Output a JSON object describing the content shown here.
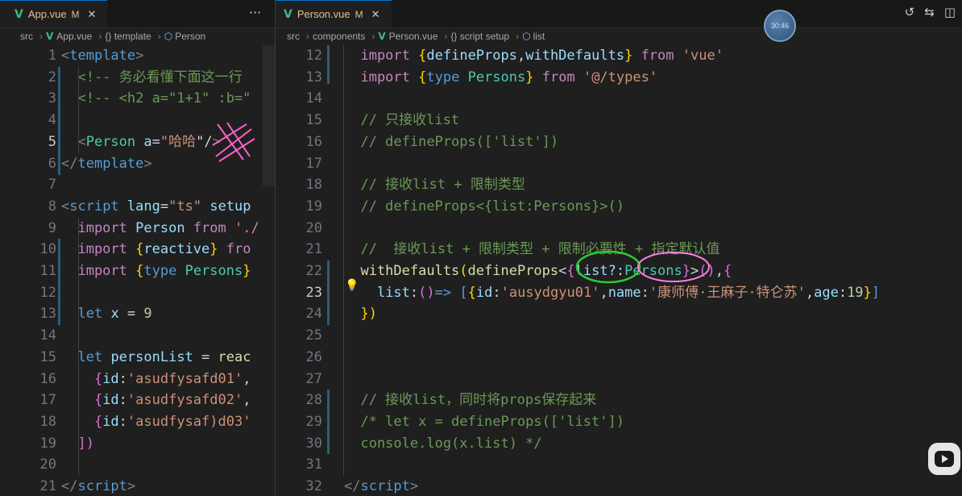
{
  "left_editor": {
    "tab": {
      "name": "App.vue",
      "modified": "M",
      "close": "✕"
    },
    "more": "···",
    "breadcrumb": [
      "src",
      "App.vue",
      "{} template",
      "Person"
    ],
    "lines": [
      {
        "n": "1",
        "t": [
          [
            "ang",
            "<"
          ],
          [
            "tag",
            "template"
          ],
          [
            "ang",
            ">"
          ]
        ]
      },
      {
        "n": "2",
        "t": [
          [
            "c",
            "  <!-- 务必看懂下面这一行"
          ]
        ]
      },
      {
        "n": "3",
        "t": [
          [
            "c",
            "  <!-- <h2 a=\"1+1\" :b=\""
          ]
        ]
      },
      {
        "n": "4",
        "t": []
      },
      {
        "n": "5",
        "t": [
          [
            "ang",
            "  <"
          ],
          [
            "t",
            "Person"
          ],
          [
            "w",
            " "
          ],
          [
            "v",
            "a"
          ],
          [
            "w",
            "="
          ],
          [
            "s",
            "\"哈哈"
          ],
          [
            "w",
            "\"/"
          ],
          [
            "ang",
            ">"
          ]
        ]
      },
      {
        "n": "6",
        "t": [
          [
            "ang",
            "</"
          ],
          [
            "tag",
            "template"
          ],
          [
            "ang",
            ">"
          ]
        ]
      },
      {
        "n": "7",
        "t": []
      },
      {
        "n": "8",
        "t": [
          [
            "ang",
            "<"
          ],
          [
            "tag",
            "script"
          ],
          [
            "w",
            " "
          ],
          [
            "v",
            "lang"
          ],
          [
            "w",
            "="
          ],
          [
            "s",
            "\"ts\""
          ],
          [
            "w",
            " "
          ],
          [
            "v",
            "setup"
          ]
        ]
      },
      {
        "n": "9",
        "t": [
          [
            "p",
            "  import"
          ],
          [
            "w",
            " "
          ],
          [
            "v",
            "Person"
          ],
          [
            "w",
            " "
          ],
          [
            "p",
            "from"
          ],
          [
            "w",
            " "
          ],
          [
            "s",
            "'./"
          ]
        ]
      },
      {
        "n": "10",
        "t": [
          [
            "p",
            "  import"
          ],
          [
            "w",
            " "
          ],
          [
            "y",
            "{"
          ],
          [
            "v",
            "reactive"
          ],
          [
            "y",
            "}"
          ],
          [
            "w",
            " "
          ],
          [
            "p",
            "fro"
          ]
        ]
      },
      {
        "n": "11",
        "t": [
          [
            "p",
            "  import"
          ],
          [
            "w",
            " "
          ],
          [
            "y",
            "{"
          ],
          [
            "k",
            "type"
          ],
          [
            "w",
            " "
          ],
          [
            "t",
            "Persons"
          ],
          [
            "y",
            "}"
          ]
        ]
      },
      {
        "n": "12",
        "t": []
      },
      {
        "n": "13",
        "t": [
          [
            "k",
            "  let"
          ],
          [
            "w",
            " "
          ],
          [
            "v",
            "x"
          ],
          [
            "w",
            " = "
          ],
          [
            "n",
            "9"
          ]
        ]
      },
      {
        "n": "14",
        "t": []
      },
      {
        "n": "15",
        "t": [
          [
            "k",
            "  let"
          ],
          [
            "w",
            " "
          ],
          [
            "v",
            "personList"
          ],
          [
            "w",
            " = "
          ],
          [
            "f",
            "reac"
          ]
        ]
      },
      {
        "n": "16",
        "t": [
          [
            "pk",
            "    {"
          ],
          [
            "v",
            "id"
          ],
          [
            "w",
            ":"
          ],
          [
            "s",
            "'asudfysafd01'"
          ],
          [
            "w",
            ","
          ]
        ]
      },
      {
        "n": "17",
        "t": [
          [
            "pk",
            "    {"
          ],
          [
            "v",
            "id"
          ],
          [
            "w",
            ":"
          ],
          [
            "s",
            "'asudfysafd02'"
          ],
          [
            "w",
            ","
          ]
        ]
      },
      {
        "n": "18",
        "t": [
          [
            "pk",
            "    {"
          ],
          [
            "v",
            "id"
          ],
          [
            "w",
            ":"
          ],
          [
            "s",
            "'asudfysaf)d03'"
          ]
        ]
      },
      {
        "n": "19",
        "t": [
          [
            "pk",
            "  ])"
          ]
        ]
      },
      {
        "n": "20",
        "t": []
      },
      {
        "n": "21",
        "t": [
          [
            "ang",
            "</"
          ],
          [
            "tag",
            "script"
          ],
          [
            "ang",
            ">"
          ]
        ]
      }
    ]
  },
  "right_editor": {
    "tab": {
      "name": "Person.vue",
      "modified": "M",
      "close": "✕"
    },
    "breadcrumb": [
      "src",
      "components",
      "Person.vue",
      "{} script setup",
      "list"
    ],
    "clock": "30:46",
    "toolbar_icons": [
      "history-icon",
      "compare-changes-icon",
      "split-editor-icon"
    ],
    "toolbar_glyphs": [
      "↺",
      "⇆",
      "◫"
    ],
    "lines": [
      {
        "n": "12",
        "t": [
          [
            "p",
            "  import"
          ],
          [
            "w",
            " "
          ],
          [
            "y",
            "{"
          ],
          [
            "v",
            "defineProps"
          ],
          [
            "w",
            ","
          ],
          [
            "v",
            "withDefaults"
          ],
          [
            "y",
            "}"
          ],
          [
            "w",
            " "
          ],
          [
            "p",
            "from"
          ],
          [
            "w",
            " "
          ],
          [
            "s",
            "'vue'"
          ]
        ]
      },
      {
        "n": "13",
        "t": [
          [
            "p",
            "  import"
          ],
          [
            "w",
            " "
          ],
          [
            "y",
            "{"
          ],
          [
            "k",
            "type"
          ],
          [
            "w",
            " "
          ],
          [
            "t",
            "Persons"
          ],
          [
            "y",
            "}"
          ],
          [
            "w",
            " "
          ],
          [
            "p",
            "from"
          ],
          [
            "w",
            " "
          ],
          [
            "s",
            "'@/types'"
          ]
        ]
      },
      {
        "n": "14",
        "t": []
      },
      {
        "n": "15",
        "t": [
          [
            "c",
            "  // 只接收list"
          ]
        ]
      },
      {
        "n": "16",
        "t": [
          [
            "c",
            "  // defineProps(['list'])"
          ]
        ]
      },
      {
        "n": "17",
        "t": []
      },
      {
        "n": "18",
        "t": [
          [
            "c",
            "  // 接收list + 限制类型"
          ]
        ]
      },
      {
        "n": "19",
        "t": [
          [
            "c",
            "  // defineProps<{list:Persons}>()"
          ]
        ]
      },
      {
        "n": "20",
        "t": []
      },
      {
        "n": "21",
        "t": [
          [
            "c",
            "  //  接收list + 限制类型 + 限制必要性 + 指定默认值"
          ]
        ]
      },
      {
        "n": "22",
        "t": [
          [
            "f",
            "  withDefaults"
          ],
          [
            "y",
            "("
          ],
          [
            "f",
            "defineProps"
          ],
          [
            "w",
            "<"
          ],
          [
            "pk",
            "{"
          ],
          [
            "v",
            "list?"
          ],
          [
            "w",
            ":"
          ],
          [
            "t",
            "Persons"
          ],
          [
            "pk",
            "}"
          ],
          [
            "w",
            ">"
          ],
          [
            "pk",
            "()"
          ],
          [
            "w",
            ","
          ],
          [
            "pk",
            "{"
          ]
        ]
      },
      {
        "n": "23",
        "t": [
          [
            "w",
            "    "
          ],
          [
            "v",
            "list"
          ],
          [
            "w",
            ":"
          ],
          [
            "pk",
            "()"
          ],
          [
            "k",
            "=>"
          ],
          [
            "w",
            " "
          ],
          [
            "k",
            "["
          ],
          [
            "y",
            "{"
          ],
          [
            "v",
            "id"
          ],
          [
            "w",
            ":"
          ],
          [
            "s",
            "'ausydgyu01'"
          ],
          [
            "w",
            ","
          ],
          [
            "v",
            "name"
          ],
          [
            "w",
            ":"
          ],
          [
            "s",
            "'康师傅·王麻子·特仑苏'"
          ],
          [
            "w",
            ","
          ],
          [
            "v",
            "age"
          ],
          [
            "w",
            ":"
          ],
          [
            "n",
            "19"
          ],
          [
            "y",
            "}"
          ],
          [
            "k",
            "]"
          ]
        ]
      },
      {
        "n": "24",
        "t": [
          [
            "y",
            "  })"
          ]
        ]
      },
      {
        "n": "25",
        "t": []
      },
      {
        "n": "26",
        "t": []
      },
      {
        "n": "27",
        "t": []
      },
      {
        "n": "28",
        "t": [
          [
            "c",
            "  // 接收list，同时将props保存起来"
          ]
        ]
      },
      {
        "n": "29",
        "t": [
          [
            "c",
            "  /* let x = defineProps(['list'])"
          ]
        ]
      },
      {
        "n": "30",
        "t": [
          [
            "c",
            "  console.log(x.list) */"
          ]
        ]
      },
      {
        "n": "31",
        "t": []
      },
      {
        "n": "32",
        "t": [
          [
            "ang",
            "</"
          ],
          [
            "tag",
            "script"
          ],
          [
            "ang",
            ">"
          ]
        ]
      }
    ]
  }
}
